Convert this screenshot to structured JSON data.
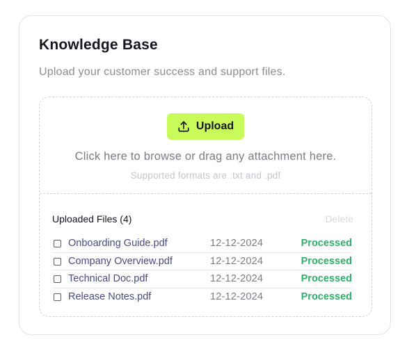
{
  "knowledge_base": {
    "title": "Knowledge Base",
    "subtitle": "Upload your customer success and support files."
  },
  "dropzone": {
    "upload_label": "Upload",
    "upload_icon": "upload-icon",
    "browse_text": "Click here to browse or drag any attachment here.",
    "formats_text": "Supported formats are .txt and .pdf"
  },
  "files": {
    "heading": "Uploaded Files (4)",
    "delete_label": "Delete",
    "items": [
      {
        "name": "Onboarding Guide.pdf",
        "date": "12-12-2024",
        "status": "Processed"
      },
      {
        "name": "Company Overview.pdf",
        "date": "12-12-2024",
        "status": "Processed"
      },
      {
        "name": "Technical Doc.pdf",
        "date": "12-12-2024",
        "status": "Processed"
      },
      {
        "name": "Release Notes.pdf",
        "date": "12-12-2024",
        "status": "Processed"
      }
    ]
  },
  "colors": {
    "accent": "#c8fa5a",
    "status_processed": "#2fae6a",
    "file_link": "#4a4b80"
  }
}
